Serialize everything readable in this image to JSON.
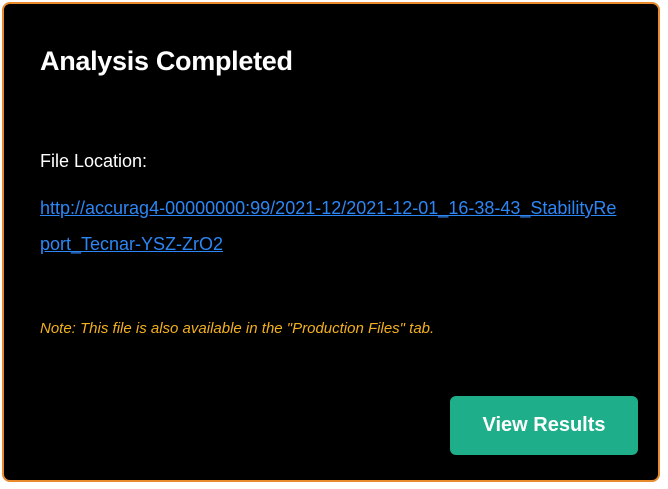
{
  "dialog": {
    "title": "Analysis Completed",
    "file_location_label": "File Location:",
    "file_link": "http://accurag4-00000000:99/2021-12/2021-12-01_16-38-43_StabilityReport_Tecnar-YSZ-ZrO2",
    "note": "Note: This file is also available in the \"Production Files\" tab.",
    "view_results_label": "View Results"
  },
  "colors": {
    "background": "#000000",
    "border_accent": "#e98a2c",
    "link": "#2d86f5",
    "note": "#f2b01e",
    "button": "#1fae8a"
  }
}
